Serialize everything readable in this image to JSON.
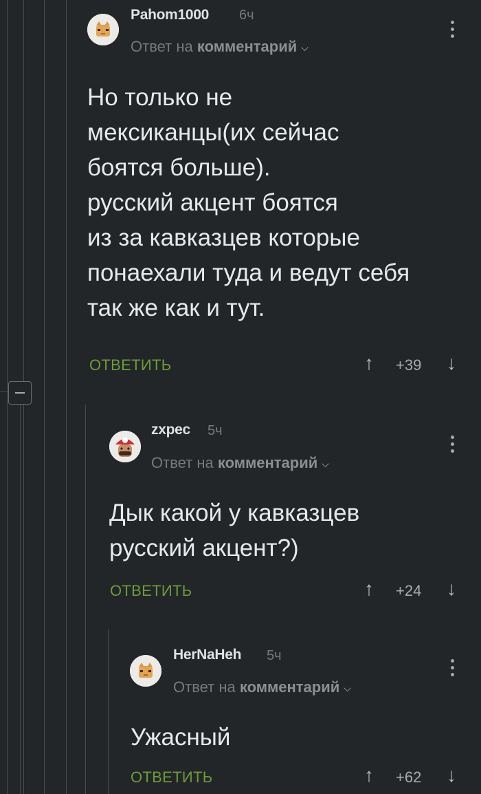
{
  "comments": [
    {
      "username": "Pahom1000",
      "time": "6ч",
      "reply_prefix": "Ответ на",
      "reply_target": "комментарий",
      "body": "Но только не\nмексиканцы(их сейчас\nбоятся больше).\nрусский акцент боятся\nиз за кавказцев которые\nпонаехали туда и ведут себя\nтак же как и тут.",
      "reply_label": "ОТВЕТИТЬ",
      "rating": "+39"
    },
    {
      "username": "zxpec",
      "time": "5ч",
      "reply_prefix": "Ответ на",
      "reply_target": "комментарий",
      "body": "Дык какой у кавказцев\nрусский акцент?)",
      "reply_label": "ОТВЕТИТЬ",
      "rating": "+24"
    },
    {
      "username": "HerNaHeh",
      "time": "5ч",
      "reply_prefix": "Ответ на",
      "reply_target": "комментарий",
      "body": "Ужасный",
      "reply_label": "ОТВЕТИТЬ",
      "rating": "+62"
    }
  ],
  "icons": {
    "upvote": "arrow-up-icon",
    "downvote": "arrow-down-icon",
    "more": "more-vertical-icon",
    "collapse": "minus-icon",
    "chevron": "chevron-down-icon"
  },
  "colors": {
    "background": "#232628",
    "reply_button": "#6c9b3c",
    "muted_text": "#75797d"
  }
}
